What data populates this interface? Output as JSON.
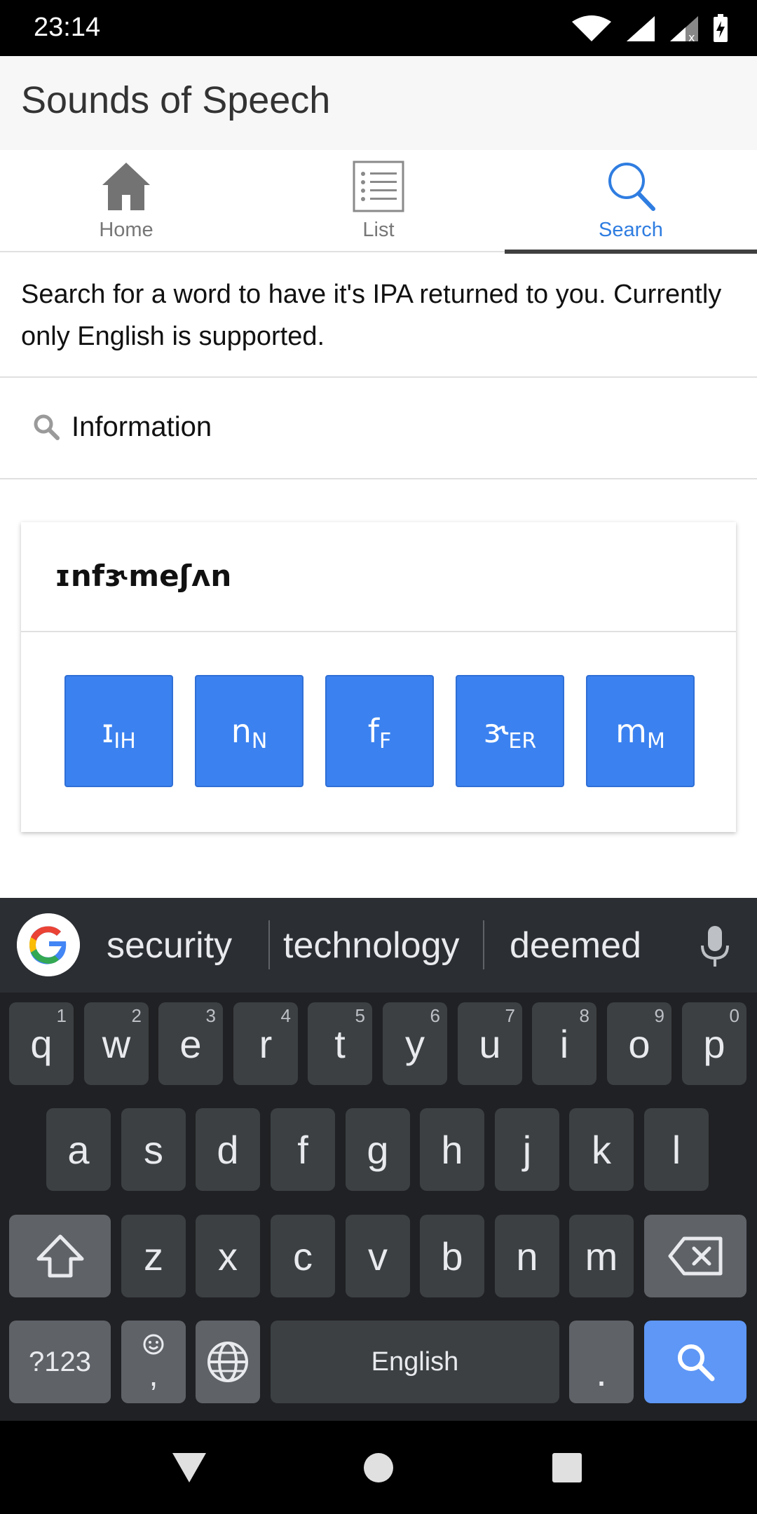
{
  "status": {
    "time": "23:14"
  },
  "app": {
    "title": "Sounds of Speech"
  },
  "tabs": [
    {
      "label": "Home",
      "icon": "home-icon"
    },
    {
      "label": "List",
      "icon": "list-icon"
    },
    {
      "label": "Search",
      "icon": "search-icon",
      "active": true
    }
  ],
  "description": "Search for a word to have it's IPA returned to you. Currently only English is supported.",
  "search": {
    "value": "Information",
    "placeholder": ""
  },
  "result": {
    "ipa": "ɪnfɝmeʃʌn",
    "phonemes": [
      {
        "symbol": "ɪ",
        "code": "IH"
      },
      {
        "symbol": "n",
        "code": "N"
      },
      {
        "symbol": "f",
        "code": "F"
      },
      {
        "symbol": "ɝ",
        "code": "ER"
      },
      {
        "symbol": "m",
        "code": "M"
      }
    ]
  },
  "keyboard": {
    "suggestions": [
      "security",
      "technology",
      "deemed"
    ],
    "row1": [
      "q",
      "w",
      "e",
      "r",
      "t",
      "y",
      "u",
      "i",
      "o",
      "p"
    ],
    "row1_hints": [
      "1",
      "2",
      "3",
      "4",
      "5",
      "6",
      "7",
      "8",
      "9",
      "0"
    ],
    "row2": [
      "a",
      "s",
      "d",
      "f",
      "g",
      "h",
      "j",
      "k",
      "l"
    ],
    "row3": [
      "z",
      "x",
      "c",
      "v",
      "b",
      "n",
      "m"
    ],
    "symbols_label": "?123",
    "comma_label": ",",
    "space_label": "English",
    "period_label": "."
  },
  "colors": {
    "accent": "#2f7de1",
    "phoneme_button": "#3b82f0",
    "keyboard_bg": "#202124",
    "key_bg": "#3c4043",
    "search_key": "#5e97f6"
  }
}
